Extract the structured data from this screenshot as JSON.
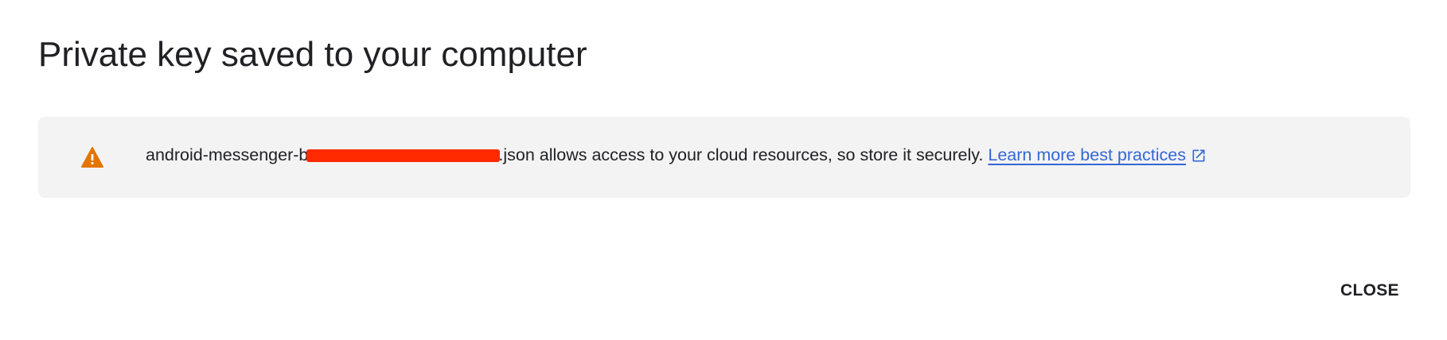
{
  "dialog": {
    "title": "Private key saved to your computer",
    "notice": {
      "icon": "warning-icon",
      "icon_color": "#e37400",
      "filename_prefix": "android-messenger-b",
      "filename_redacted": true,
      "redaction_color": "#ff2a00",
      "message_suffix": ".json allows access to your cloud resources, so store it securely.",
      "link_label": "Learn more best practices",
      "link_icon": "open-in-new-icon",
      "link_color": "#3367d6"
    },
    "close_label": "CLOSE"
  }
}
